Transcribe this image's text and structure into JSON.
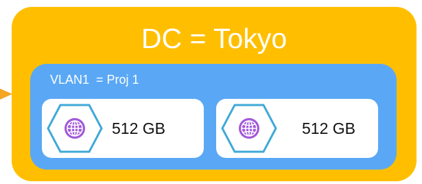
{
  "datacenter": {
    "title": "DC = Tokyo"
  },
  "vlan": {
    "label": "VLAN1  = Proj 1"
  },
  "nodes": [
    {
      "icon": "globe-hexagon-icon",
      "size": "512 GB"
    },
    {
      "icon": "globe-hexagon-icon",
      "size": "512 GB"
    }
  ],
  "colors": {
    "datacenter_fill": "#ffbf00",
    "vlan_fill": "#5aa8f5",
    "node_fill": "#ffffff",
    "hex_stroke": "#3fa9d6",
    "globe": "#a259d9",
    "arrow": "#f5a623"
  }
}
